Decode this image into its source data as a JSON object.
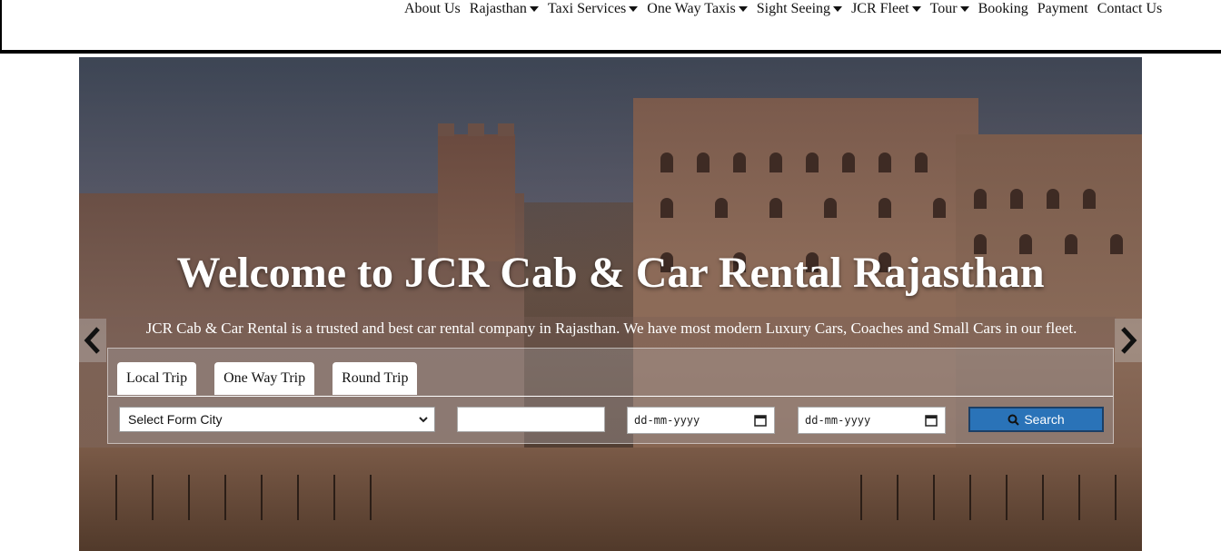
{
  "nav": {
    "items": [
      {
        "label": "About Us",
        "dropdown": false
      },
      {
        "label": "Rajasthan",
        "dropdown": true
      },
      {
        "label": "Taxi Services",
        "dropdown": true
      },
      {
        "label": "One Way Taxis",
        "dropdown": true
      },
      {
        "label": "Sight Seeing",
        "dropdown": true
      },
      {
        "label": "JCR Fleet",
        "dropdown": true
      },
      {
        "label": "Tour",
        "dropdown": true
      },
      {
        "label": "Booking",
        "dropdown": false
      },
      {
        "label": "Payment",
        "dropdown": false
      },
      {
        "label": "Contact Us",
        "dropdown": false
      }
    ]
  },
  "hero": {
    "title": "Welcome to JCR Cab & Car Rental Rajasthan",
    "description": "JCR Cab & Car Rental is a trusted and best car rental company in Rajasthan. We have most modern Luxury Cars, Coaches and Small Cars in our fleet."
  },
  "search": {
    "tabs": [
      "Local Trip",
      "One Way Trip",
      "Round Trip"
    ],
    "city_select": "Select Form City",
    "pickup_date_placeholder": "dd-mm-yyyy",
    "return_date_placeholder": "dd-mm-yyyy",
    "search_label": "Search"
  },
  "icons": {
    "prev": "chevron-left-icon",
    "next": "chevron-right-icon",
    "search": "search-icon",
    "calendar": "calendar-icon",
    "caret": "caret-down-icon"
  },
  "colors": {
    "search_button": "#2a73b8",
    "header_border": "#000000"
  }
}
